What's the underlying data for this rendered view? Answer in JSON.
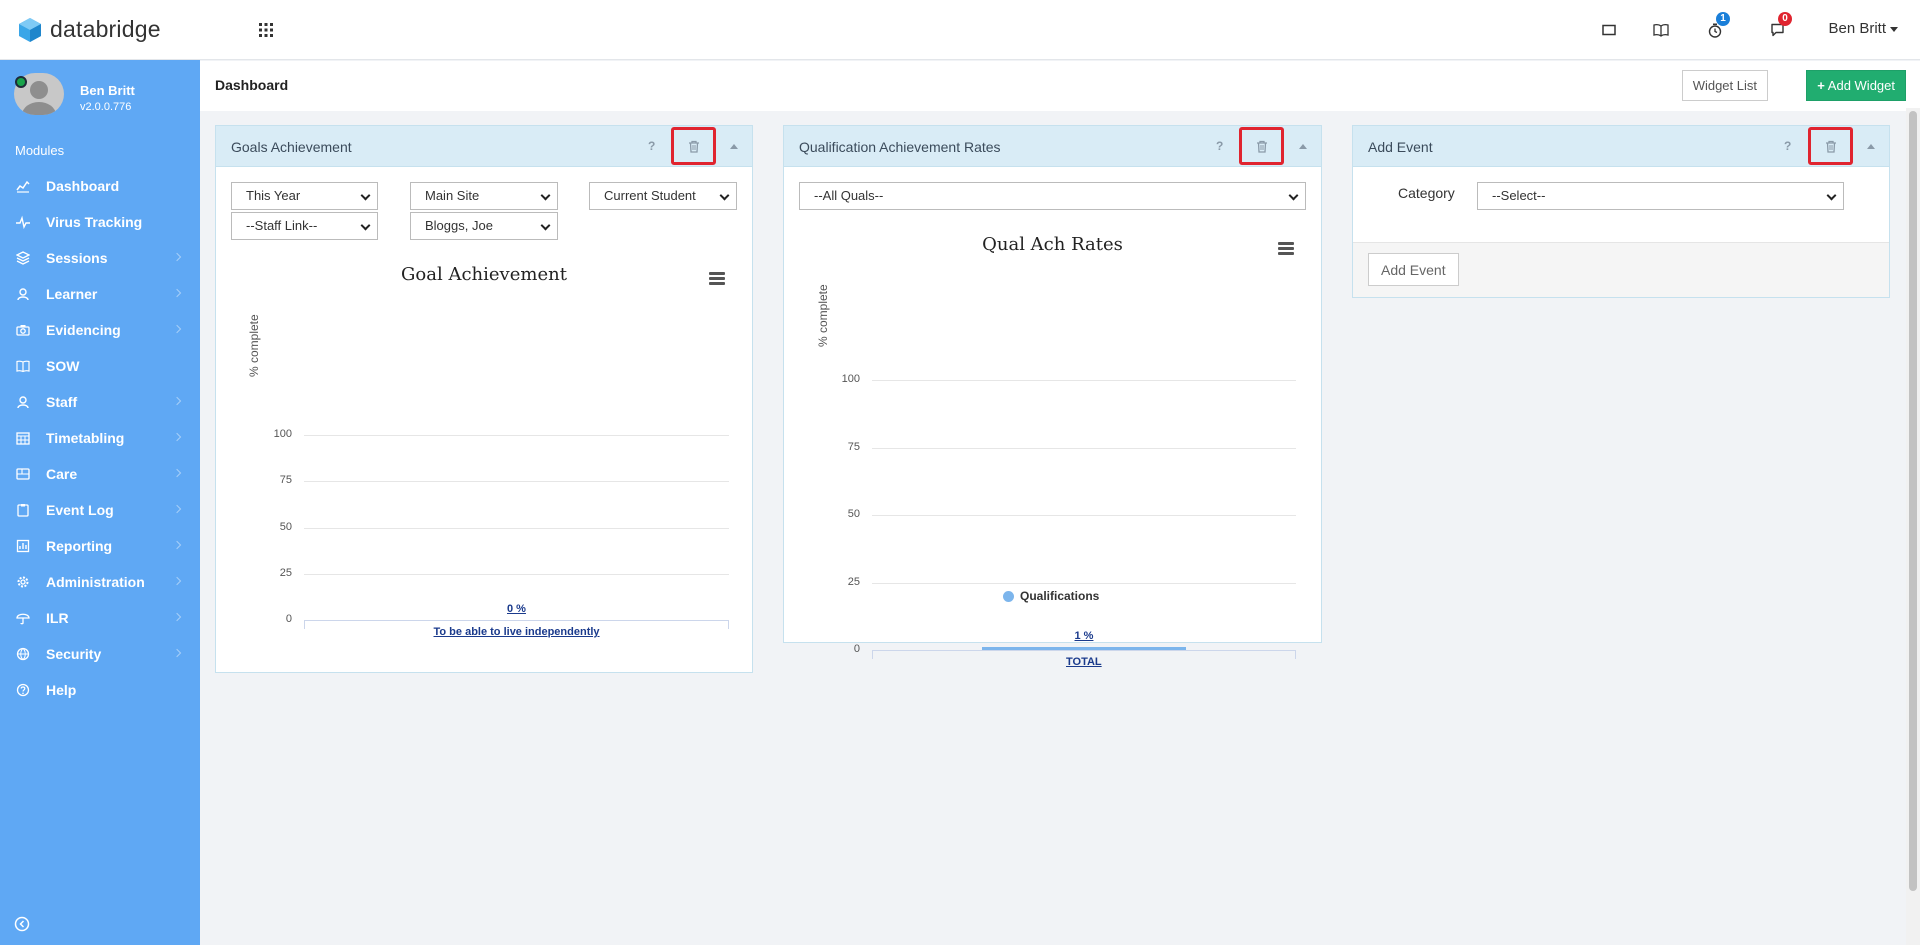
{
  "app": {
    "logo_text": "databridge",
    "brand_color": "#5fa8f4",
    "user_label": "Ben Britt",
    "icons": [
      "apps-grid-icon",
      "screen-icon",
      "book-icon",
      "timer-icon",
      "chat-icon"
    ],
    "badges": {
      "timer": "1",
      "chat": "0"
    },
    "badge_colors": {
      "timer": "#1a7fd9",
      "chat": "#e0242f"
    }
  },
  "sidebar": {
    "profile_name": "Ben Britt",
    "version": "v2.0.0.776",
    "modules_label": "Modules",
    "items": [
      {
        "label": "Dashboard",
        "icon": "chart-line-icon",
        "chevron": false
      },
      {
        "label": "Virus Tracking",
        "icon": "pulse-icon",
        "chevron": false
      },
      {
        "label": "Sessions",
        "icon": "layers-icon",
        "chevron": true
      },
      {
        "label": "Learner",
        "icon": "user-icon",
        "chevron": true
      },
      {
        "label": "Evidencing",
        "icon": "camera-icon",
        "chevron": true
      },
      {
        "label": "SOW",
        "icon": "book-open-icon",
        "chevron": false
      },
      {
        "label": "Staff",
        "icon": "staff-icon",
        "chevron": true
      },
      {
        "label": "Timetabling",
        "icon": "calendar-icon",
        "chevron": true
      },
      {
        "label": "Care",
        "icon": "card-icon",
        "chevron": true
      },
      {
        "label": "Event Log",
        "icon": "clipboard-icon",
        "chevron": true
      },
      {
        "label": "Reporting",
        "icon": "report-icon",
        "chevron": true
      },
      {
        "label": "Administration",
        "icon": "gear-icon",
        "chevron": true
      },
      {
        "label": "ILR",
        "icon": "umbrella-icon",
        "chevron": true
      },
      {
        "label": "Security",
        "icon": "globe-icon",
        "chevron": true
      },
      {
        "label": "Help",
        "icon": "help-circle-icon",
        "chevron": false
      }
    ]
  },
  "header": {
    "page_title": "Dashboard",
    "widget_list_label": "Widget List",
    "add_widget_label": "Add Widget"
  },
  "widgets": {
    "goals": {
      "title": "Goals Achievement",
      "help": "?",
      "filters": {
        "period": "This Year",
        "site": "Main Site",
        "status": "Current Student",
        "staff": "--Staff Link--",
        "learner": "Bloggs, Joe"
      },
      "chart_title": "Goal Achievement",
      "ytitle": "% complete"
    },
    "quals": {
      "title": "Qualification Achievement Rates",
      "help": "?",
      "filter": "--All Quals--",
      "chart_title": "Qual Ach Rates",
      "ytitle": "% complete",
      "legend": "Qualifications"
    },
    "event": {
      "title": "Add Event",
      "help": "?",
      "category_label": "Category",
      "category_value": "--Select--",
      "add_event_label": "Add Event"
    }
  },
  "chart_data": [
    {
      "type": "bar",
      "title": "Goal Achievement",
      "ylabel": "% complete",
      "ylim": [
        0,
        100
      ],
      "yticks": [
        0,
        25,
        50,
        75,
        100
      ],
      "categories": [
        "To be able to live independently"
      ],
      "values": [
        0
      ],
      "data_labels": [
        "0 %"
      ],
      "grid": true
    },
    {
      "type": "bar",
      "title": "Qual Ach Rates",
      "ylabel": "% complete",
      "ylim": [
        0,
        100
      ],
      "yticks": [
        0,
        25,
        50,
        75,
        100
      ],
      "categories": [
        "TOTAL"
      ],
      "series": [
        {
          "name": "Qualifications",
          "values": [
            1
          ]
        }
      ],
      "data_labels": [
        "1 %"
      ],
      "legend": "bottom-center",
      "grid": true
    }
  ]
}
